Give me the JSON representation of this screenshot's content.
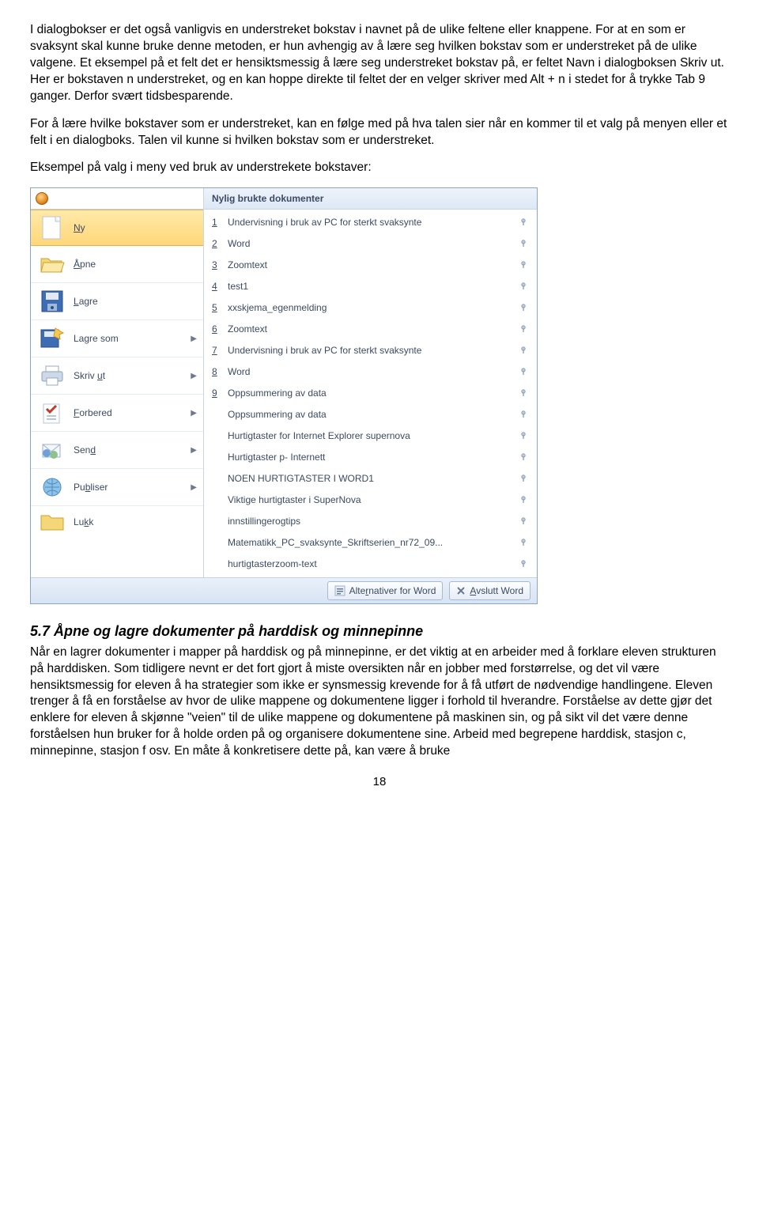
{
  "para1": "I dialogbokser er det også vanligvis en understreket bokstav i navnet på de ulike feltene eller knappene. For at en som er svaksynt skal kunne bruke denne metoden, er hun avhengig av å lære seg hvilken bokstav som er understreket på de ulike valgene. Et eksempel på et felt det er hensiktsmessig å lære seg understreket bokstav på, er feltet Navn i dialogboksen Skriv ut. Her er bokstaven n understreket, og en kan hoppe direkte til feltet der en velger skriver med Alt + n i stedet for å trykke Tab 9 ganger. Derfor svært tidsbesparende.",
  "para2": "For å lære hvilke bokstaver som er understreket, kan en følge med på hva talen sier når en kommer til et valg på menyen eller et felt i en dialogboks. Talen vil kunne si hvilken bokstav som er understreket.",
  "para3": "Eksempel på valg i meny ved bruk av understrekete bokstaver:",
  "menu": {
    "recentHeader": "Nylig brukte dokumenter",
    "left": [
      {
        "label": "Ny",
        "ul": "N",
        "rest": "y",
        "arrow": false
      },
      {
        "label": "Åpne",
        "ul": "Å",
        "rest": "pne",
        "arrow": false
      },
      {
        "label": "Lagre",
        "ul": "L",
        "rest": "agre",
        "arrow": false
      },
      {
        "label": "Lagre som",
        "ul": "",
        "rest": "Lagre som",
        "arrow": true,
        "ulSpec": "g"
      },
      {
        "label": "Skriv ut",
        "ul": "",
        "rest": "Skriv ut",
        "arrow": true,
        "ulSpec": "u"
      },
      {
        "label": "Forbered",
        "ul": "F",
        "rest": "orbered",
        "arrow": true
      },
      {
        "label": "Send",
        "ul": "",
        "rest": "Send",
        "arrow": true,
        "ulSpec": "d"
      },
      {
        "label": "Publiser",
        "ul": "",
        "rest": "Publiser",
        "arrow": true,
        "ulSpec": "b"
      },
      {
        "label": "Lukk",
        "ul": "",
        "rest": "Lukk",
        "arrow": false,
        "ulSpec": "k"
      }
    ],
    "recent": [
      {
        "n": "1",
        "label": "Undervisning i bruk av PC for sterkt svaksynte"
      },
      {
        "n": "2",
        "label": "Word"
      },
      {
        "n": "3",
        "label": "Zoomtext"
      },
      {
        "n": "4",
        "label": "test1"
      },
      {
        "n": "5",
        "label": "xxskjema_egenmelding"
      },
      {
        "n": "6",
        "label": "Zoomtext"
      },
      {
        "n": "7",
        "label": "Undervisning i bruk av PC for sterkt svaksynte"
      },
      {
        "n": "8",
        "label": "Word"
      },
      {
        "n": "9",
        "label": "Oppsummering av data"
      },
      {
        "n": "",
        "label": "Oppsummering av data"
      },
      {
        "n": "",
        "label": "Hurtigtaster for Internet Explorer supernova"
      },
      {
        "n": "",
        "label": "Hurtigtaster p- Internett"
      },
      {
        "n": "",
        "label": "NOEN HURTIGTASTER I WORD1"
      },
      {
        "n": "",
        "label": "Viktige hurtigtaster i SuperNova"
      },
      {
        "n": "",
        "label": "innstillingerogtips"
      },
      {
        "n": "",
        "label": "Matematikk_PC_svaksynte_Skriftserien_nr72_09..."
      },
      {
        "n": "",
        "label": "hurtigtasterzoom-text"
      }
    ],
    "options": "Alternativer for Word",
    "optUl": "r",
    "exit": "Avslutt Word",
    "exitUl": "A"
  },
  "secTitle": "5.7 Åpne og lagre dokumenter på harddisk og minnepinne",
  "para4": "Når en lagrer dokumenter i mapper på harddisk og på minnepinne, er det viktig at en arbeider med å forklare eleven strukturen på harddisken. Som tidligere nevnt er det fort gjort å miste oversikten når en jobber med forstørrelse, og det vil være hensiktsmessig for eleven å ha strategier som ikke er synsmessig krevende for å få utført de nødvendige handlingene. Eleven trenger å få en forståelse av hvor de ulike mappene og dokumentene ligger i forhold til hverandre. Forståelse av dette gjør det enklere for eleven å skjønne \"veien\" til de ulike mappene og dokumentene på maskinen sin, og på sikt vil det være denne forståelsen hun bruker for å holde orden på og organisere dokumentene sine. Arbeid med begrepene harddisk, stasjon c, minnepinne, stasjon f osv. En måte å konkretisere dette på, kan være å bruke",
  "pageNum": "18"
}
